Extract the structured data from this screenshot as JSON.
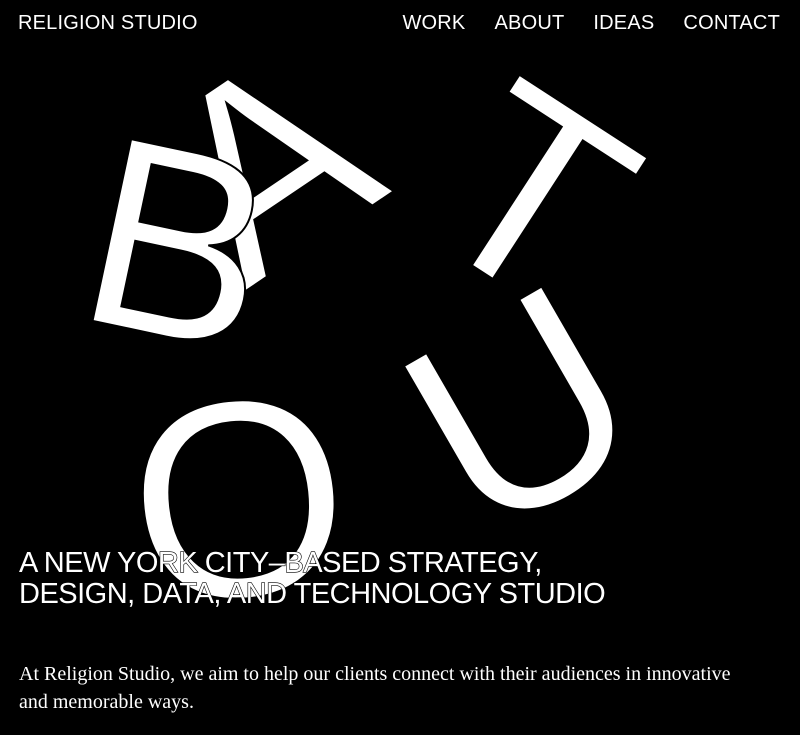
{
  "header": {
    "logo": "RELIGION STUDIO",
    "nav": [
      "WORK",
      "ABOUT",
      "IDEAS",
      "CONTACT"
    ]
  },
  "hero": {
    "letters": [
      "A",
      "B",
      "T",
      "O",
      "U"
    ],
    "tagline_line1": "A NEW YORK CITY–BASED STRATEGY,",
    "tagline_line2": "DESIGN, DATA, AND TECHNOLOGY STUDIO"
  },
  "intro": "At Religion Studio, we aim to help our clients connect with their audiences in innovative and memorable ways.",
  "colors": {
    "background": "#000000",
    "text": "#ffffff"
  }
}
